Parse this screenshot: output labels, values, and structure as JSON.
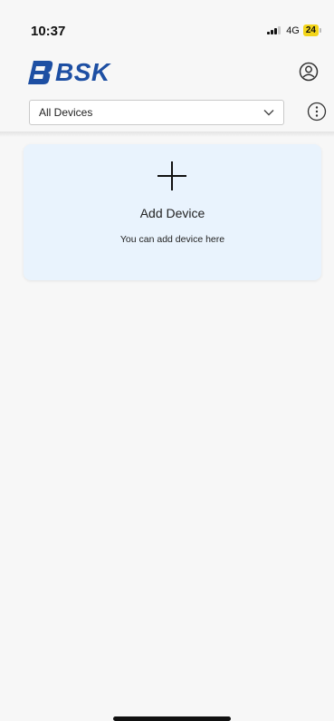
{
  "status_bar": {
    "time": "10:37",
    "network": "4G",
    "battery": "24"
  },
  "header": {
    "logo_text": "BSK",
    "brand_color": "#1d4fa3",
    "account_icon": "account-circle-icon"
  },
  "filter": {
    "selected_value": "All Devices",
    "info_icon": "more-vertical-circle-icon"
  },
  "add_card": {
    "icon": "plus-icon",
    "title": "Add Device",
    "subtitle": "You can add device here",
    "background": "#e9f3fd"
  }
}
